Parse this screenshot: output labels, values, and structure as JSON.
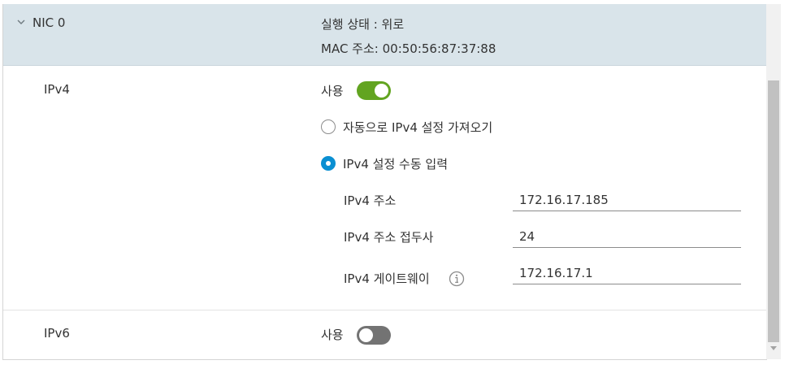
{
  "nic": {
    "title": "NIC 0",
    "status": "실행 상태 : 위로",
    "mac": "MAC 주소: 00:50:56:87:37:88"
  },
  "ipv4": {
    "label": "IPv4",
    "use_label": "사용",
    "enabled": true,
    "radio_auto_label": "자동으로 IPv4 설정 가져오기",
    "radio_manual_label": "IPv4 설정 수동 입력",
    "selected_mode": "manual",
    "fields": {
      "address_label": "IPv4 주소",
      "address_value": "172.16.17.185",
      "prefix_label": "IPv4 주소 접두사",
      "prefix_value": "24",
      "gateway_label": "IPv4 게이트웨이",
      "gateway_value": "172.16.17.1"
    }
  },
  "ipv6": {
    "label": "IPv6",
    "use_label": "사용",
    "enabled": false
  },
  "colors": {
    "header_bg": "#d9e4ea",
    "toggle_on": "#62a420",
    "toggle_off": "#737373",
    "radio_selected": "#0a8fd2"
  },
  "icons": {
    "collapse": "chevron-down-icon",
    "info": "info-icon"
  }
}
